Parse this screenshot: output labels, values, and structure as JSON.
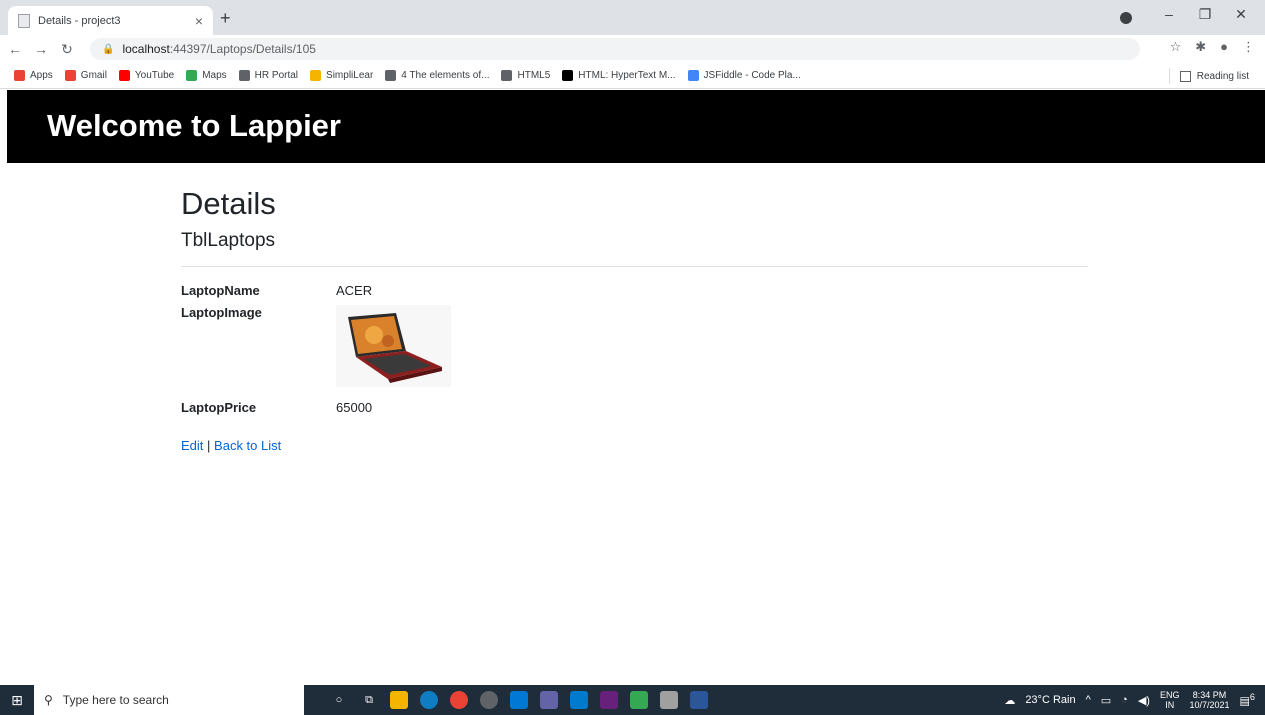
{
  "browser": {
    "tab_title": "Details - project3",
    "tab_close": "×",
    "new_tab": "+",
    "url_host": "localhost",
    "url_path": ":44397/Laptops/Details/105",
    "bookmarks": [
      {
        "label": "Apps",
        "icon": "apps-grid-icon",
        "color": "#ea4335"
      },
      {
        "label": "Gmail",
        "icon": "gmail-icon",
        "color": "#ea4335"
      },
      {
        "label": "YouTube",
        "icon": "youtube-icon",
        "color": "#ff0000"
      },
      {
        "label": "Maps",
        "icon": "maps-icon",
        "color": "#34a853"
      },
      {
        "label": "HR Portal",
        "icon": "globe-icon",
        "color": "#5f6368"
      },
      {
        "label": "SimpliLear",
        "icon": "simplilearn-icon",
        "color": "#f4b400"
      },
      {
        "label": "4 The elements of...",
        "icon": "globe-icon",
        "color": "#5f6368"
      },
      {
        "label": "HTML5",
        "icon": "globe-icon",
        "color": "#5f6368"
      },
      {
        "label": "HTML: HyperText M...",
        "icon": "mdn-icon",
        "color": "#000000"
      },
      {
        "label": "JSFiddle - Code Pla...",
        "icon": "jsfiddle-icon",
        "color": "#4285f4"
      }
    ],
    "reading_list": "Reading list"
  },
  "site": {
    "brand": "Welcome to Lappier"
  },
  "page": {
    "title": "Details",
    "subtitle": "TblLaptops",
    "fields": {
      "name_label": "LaptopName",
      "name_value": "ACER",
      "image_label": "LaptopImage",
      "price_label": "LaptopPrice",
      "price_value": "65000"
    },
    "edit_link": "Edit",
    "separator": "|",
    "back_link": "Back to List"
  },
  "taskbar": {
    "search_placeholder": "Type here to search",
    "weather": "23°C Rain",
    "lang_top": "ENG",
    "lang_bottom": "IN",
    "time": "8:34 PM",
    "date": "10/7/2021",
    "notification_count": "6"
  }
}
